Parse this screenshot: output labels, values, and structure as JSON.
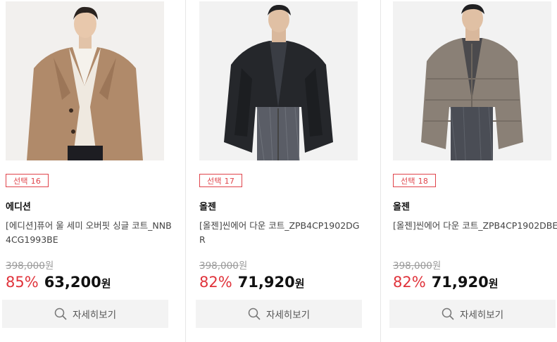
{
  "products": [
    {
      "badge": "선택 16",
      "brand": "에디션",
      "name": "[에디션]퓨어 울 세미 오버핏 싱글 코트_NNB4CG1993BE",
      "original_price": "398,000",
      "original_unit": "원",
      "discount": "85%",
      "price": "63,200",
      "price_unit": "원",
      "button_label": "자세히보기",
      "image_icon": "camel-overcoat-photo",
      "coat_color": "#b08a6a"
    },
    {
      "badge": "선택 17",
      "brand": "올젠",
      "name": "[올젠]씬에어 다운 코트_ZPB4CP1902DGR",
      "original_price": "398,000",
      "original_unit": "원",
      "discount": "82%",
      "price": "71,920",
      "price_unit": "원",
      "button_label": "자세히보기",
      "image_icon": "black-down-coat-photo",
      "coat_color": "#25272b"
    },
    {
      "badge": "선택 18",
      "brand": "올젠",
      "name": "[올젠]씬에어 다운 코트_ZPB4CP1902DBE",
      "original_price": "398,000",
      "original_unit": "원",
      "discount": "82%",
      "price": "71,920",
      "price_unit": "원",
      "button_label": "자세히보기",
      "image_icon": "taupe-down-coat-photo",
      "coat_color": "#8a8076"
    }
  ],
  "colors": {
    "accent_red": "#e0333b",
    "button_bg": "#f3f3f3",
    "strike_gray": "#9a9a9a"
  }
}
